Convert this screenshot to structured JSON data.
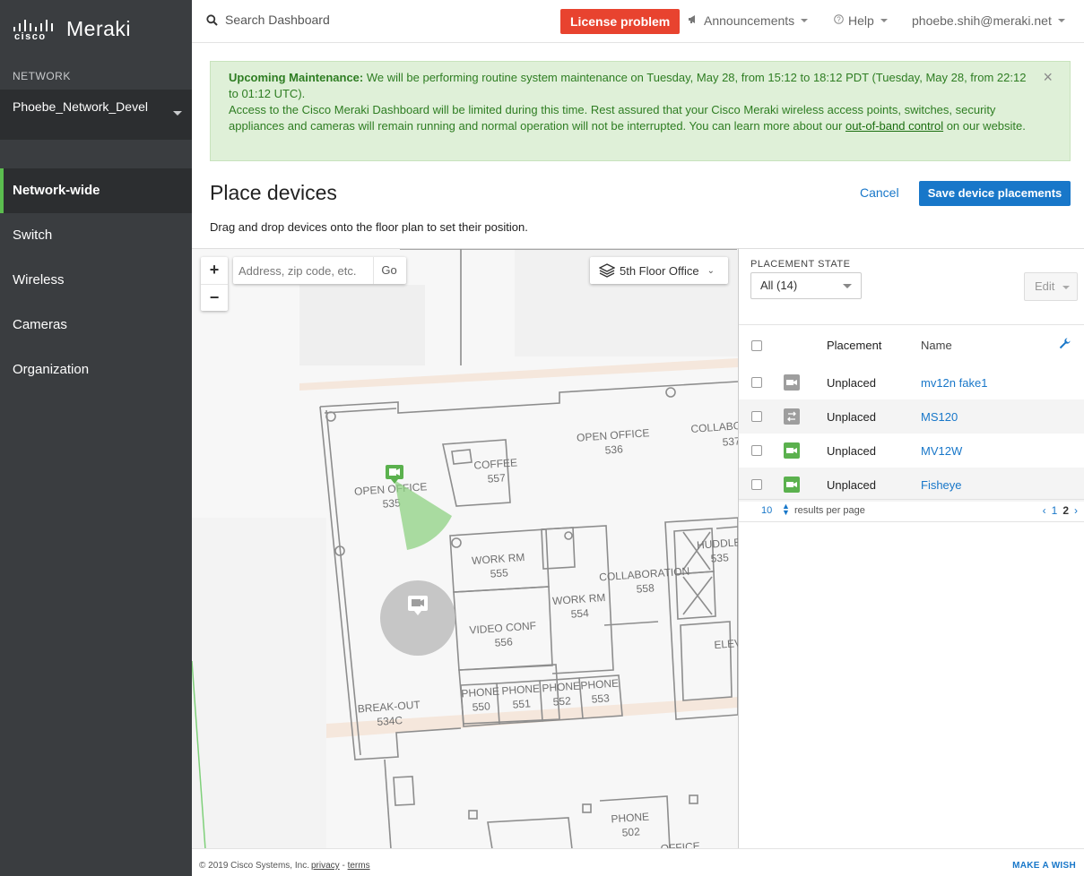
{
  "brand": {
    "logo_word": "cisco",
    "product": "Meraki"
  },
  "sidebar": {
    "section_label": "NETWORK",
    "network_name": "Phoebe_Network_Devel",
    "items": [
      {
        "label": "Network-wide",
        "active": true
      },
      {
        "label": "Switch"
      },
      {
        "label": "Wireless"
      },
      {
        "label": "Cameras"
      },
      {
        "label": "Organization"
      }
    ]
  },
  "topbar": {
    "search_label": "Search Dashboard",
    "license_label": "License problem",
    "announcements_label": "Announcements",
    "help_label": "Help",
    "user_label": "phoebe.shih@meraki.net"
  },
  "banner": {
    "heading": "Upcoming Maintenance:",
    "line1": " We will be performing routine system maintenance on Tuesday, May 28, from 15:12 to 18:12 PDT (Tuesday, May 28, from 22:12 to 01:12 UTC).",
    "line2": "Access to the Cisco Meraki Dashboard will be limited during this time. Rest assured that your Cisco Meraki wireless access points, switches, security appliances and cameras will remain running and normal operation will not be interrupted. You can learn more about our ",
    "link": "out-of-band control",
    "line2_end": " on our website.",
    "close": "×"
  },
  "page": {
    "title": "Place devices",
    "cancel_label": "Cancel",
    "save_label": "Save device placements",
    "instructions": "Drag and drop devices onto the floor plan to set their position."
  },
  "map": {
    "zoom_in": "+",
    "zoom_out": "−",
    "address_placeholder": "Address, zip code, etc.",
    "go_label": "Go",
    "floor_label": "5th Floor Office",
    "rooms": [
      {
        "name": "OPEN OFFICE",
        "num": "535"
      },
      {
        "name": "COFFEE",
        "num": "557"
      },
      {
        "name": "OPEN OFFICE",
        "num": "536"
      },
      {
        "name": "COLLABO",
        "num": "537"
      },
      {
        "name": "WORK RM",
        "num": "555"
      },
      {
        "name": "WORK RM",
        "num": "554"
      },
      {
        "name": "COLLABORATION",
        "num": "558"
      },
      {
        "name": "HUDDLE",
        "num": "535"
      },
      {
        "name": "VIDEO CONF",
        "num": "556"
      },
      {
        "name": "ELEV",
        "num": ""
      },
      {
        "name": "BREAK-OUT",
        "num": "534C"
      },
      {
        "name": "PHONE",
        "num": "550"
      },
      {
        "name": "PHONE",
        "num": "551"
      },
      {
        "name": "PHONE",
        "num": "552"
      },
      {
        "name": "PHONE",
        "num": "553"
      },
      {
        "name": "PHONE",
        "num": "502"
      },
      {
        "name": "OFFICE",
        "num": ""
      }
    ]
  },
  "panel": {
    "placement_state_label": "PLACEMENT STATE",
    "placement_state_value": "All (14)",
    "edit_label": "Edit",
    "columns": {
      "placement": "Placement",
      "name": "Name"
    },
    "rows": [
      {
        "placement": "Unplaced",
        "name": "mv12n fake1",
        "icon": "camera-icon",
        "icon_color": "#9e9e9e"
      },
      {
        "placement": "Unplaced",
        "name": "MS120",
        "icon": "switch-icon",
        "icon_color": "#9e9e9e"
      },
      {
        "placement": "Unplaced",
        "name": "MV12W",
        "icon": "camera-icon",
        "icon_color": "#5bb14e"
      },
      {
        "placement": "Unplaced",
        "name": "Fisheye",
        "icon": "camera-icon",
        "icon_color": "#5bb14e"
      }
    ],
    "per_page": "10",
    "per_page_label": "results per page",
    "pages": [
      "1",
      "2"
    ],
    "current_page": "2"
  },
  "footer": {
    "copyright": "© 2019 Cisco Systems, Inc.",
    "privacy": "privacy",
    "separator": " - ",
    "terms": "terms",
    "wish": "MAKE A WISH"
  },
  "colors": {
    "sidebar_bg": "#3a3d40",
    "accent_green": "#5bbd4e",
    "link_blue": "#1877c9",
    "license_red": "#e8432f",
    "banner_bg": "#dff0d8"
  }
}
